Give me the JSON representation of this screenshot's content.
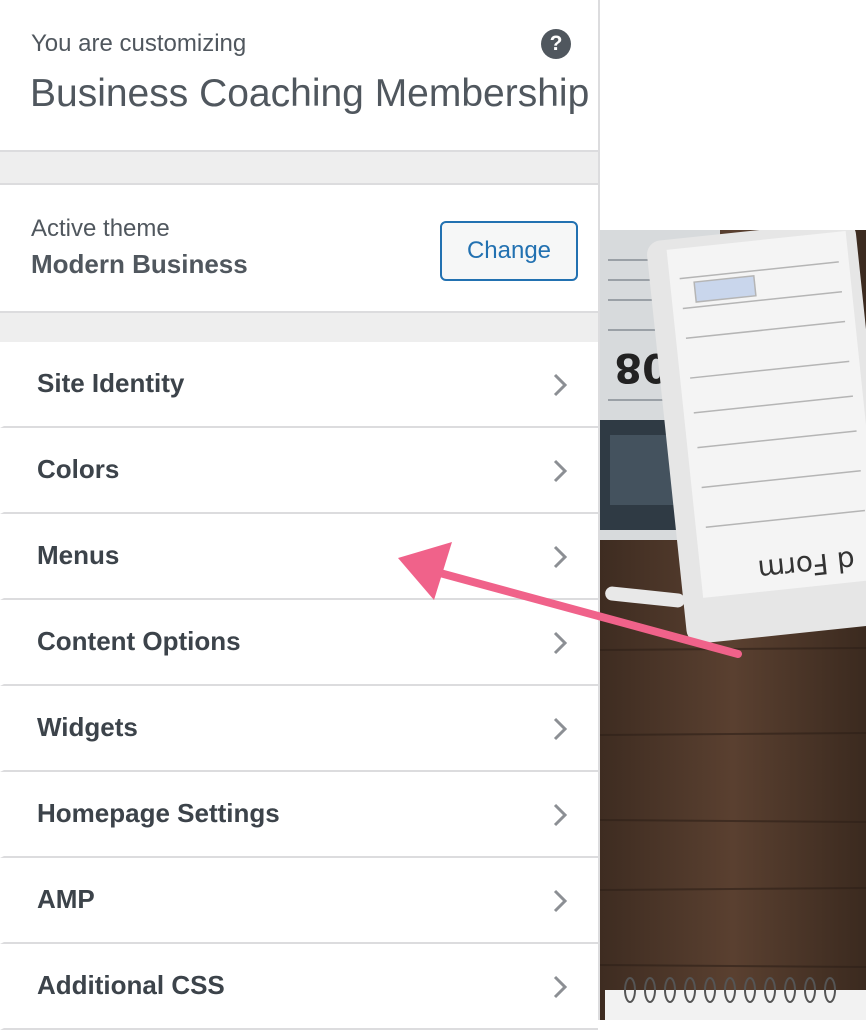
{
  "header": {
    "info_label": "You are customizing",
    "site_title": "Business Coaching Membership",
    "help_icon": "question-circle-icon"
  },
  "theme": {
    "label": "Active theme",
    "name": "Modern Business",
    "change_label": "Change"
  },
  "menu": {
    "items": [
      {
        "label": "Site Identity"
      },
      {
        "label": "Colors"
      },
      {
        "label": "Menus"
      },
      {
        "label": "Content Options"
      },
      {
        "label": "Widgets"
      },
      {
        "label": "Homepage Settings"
      },
      {
        "label": "AMP"
      },
      {
        "label": "Additional CSS"
      }
    ],
    "chevron_icon": "chevron-right-icon"
  },
  "preview": {
    "form_text": "d Form",
    "newspaper_text": "08"
  },
  "colors": {
    "accent": "#2271b1",
    "text": "#50575e",
    "arrow": "#f0628a",
    "wood": "#4a3426"
  }
}
